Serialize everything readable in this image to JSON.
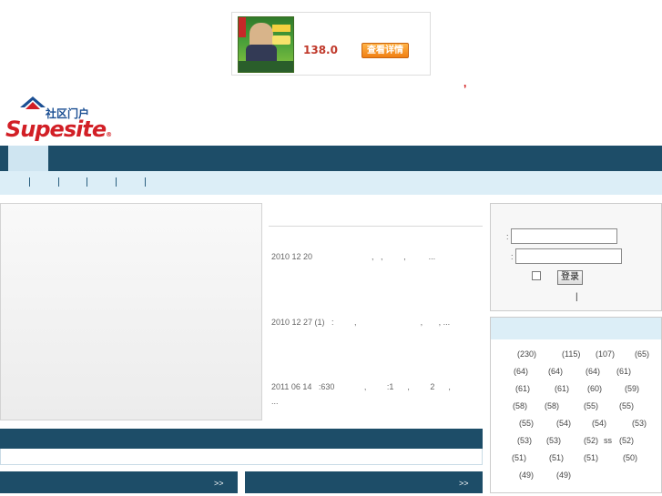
{
  "ad": {
    "price": "138.0",
    "button_label": "查看详情"
  },
  "header": {
    "red_mark": ",",
    "logo_cn": "社区门户",
    "logo_en": "Supesite",
    "logo_tm": "®"
  },
  "articles": [
    {
      "text": "2010 12 20                          ,   ,         ,          ..."
    },
    {
      "text": "2010 12 27 (1)   :         ,                            ,       , ..."
    },
    {
      "text": "2011 06 14   :630             ,         :1      ,         2      ,"
    },
    {
      "text": "..."
    }
  ],
  "sections": {
    "more_left": ">>",
    "more_right": ">>"
  },
  "login": {
    "colon": ":",
    "username_value": "",
    "password_value": "",
    "button_label": "登录",
    "pipe": "|"
  },
  "tags": [
    {
      "label": "(230)"
    },
    {
      "label": "(115)"
    },
    {
      "label": "(107)"
    },
    {
      "label": "(65)"
    },
    {
      "label": "(64)"
    },
    {
      "label": "(64)"
    },
    {
      "label": "(64)"
    },
    {
      "label": "(61)"
    },
    {
      "label": "(61)"
    },
    {
      "label": "(61)"
    },
    {
      "label": "(60)"
    },
    {
      "label": "(59)"
    },
    {
      "label": "(58)"
    },
    {
      "label": "(58)"
    },
    {
      "label": "(55)"
    },
    {
      "label": "(55)"
    },
    {
      "label": "(55)"
    },
    {
      "label": "(54)"
    },
    {
      "label": "(54)"
    },
    {
      "label": "(53)"
    },
    {
      "label": "(53)"
    },
    {
      "label": "(53)"
    },
    {
      "label": "(52)"
    },
    {
      "label": "ss"
    },
    {
      "label": "(52)"
    },
    {
      "label": "(51)"
    },
    {
      "label": "(51)"
    },
    {
      "label": "(51)"
    },
    {
      "label": "(50)"
    },
    {
      "label": "(49)"
    },
    {
      "label": "(49)"
    }
  ],
  "colors": {
    "nav_dark": "#1d4d68",
    "nav_light": "#dceef7",
    "logo_red": "#d21f26",
    "logo_blue": "#1b4f93",
    "price_red": "#c0392b"
  }
}
